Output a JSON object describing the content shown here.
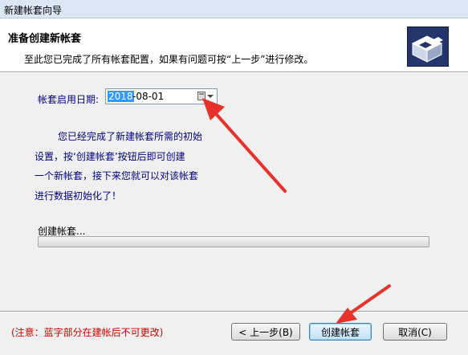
{
  "window": {
    "title": "新建帐套向导"
  },
  "header": {
    "title": "准备创建新帐套",
    "subtitle": "至此您已完成了所有帐套配置，如果有问题可按“上一步”进行修改。",
    "logo_icon": "setup-box-icon"
  },
  "form": {
    "date_label": "帐套启用日期:",
    "date_selected": "2018",
    "date_rest": "-08-01",
    "calendar_icon": "calendar-icon",
    "dropdown_icon": "chevron-down-icon"
  },
  "message": {
    "line1": "您已经完成了新建帐套所需的初始",
    "line2": "设置，按‘创建帐套’按钮后即可创建",
    "line3": "一个新帐套，接下来您就可以对该帐套",
    "line4": "进行数据初始化了！"
  },
  "progress": {
    "label": "创建帐套...",
    "value": 0
  },
  "footer": {
    "note": "(注意：蓝字部分在建帐后不可更改)",
    "back_label": "< 上一步(B)",
    "create_label": "创建帐套",
    "cancel_label": "取消(C)"
  },
  "colors": {
    "annotation": "#e8312a",
    "progress": "#59b84b",
    "accent_text": "#000080",
    "note": "#d00000"
  }
}
